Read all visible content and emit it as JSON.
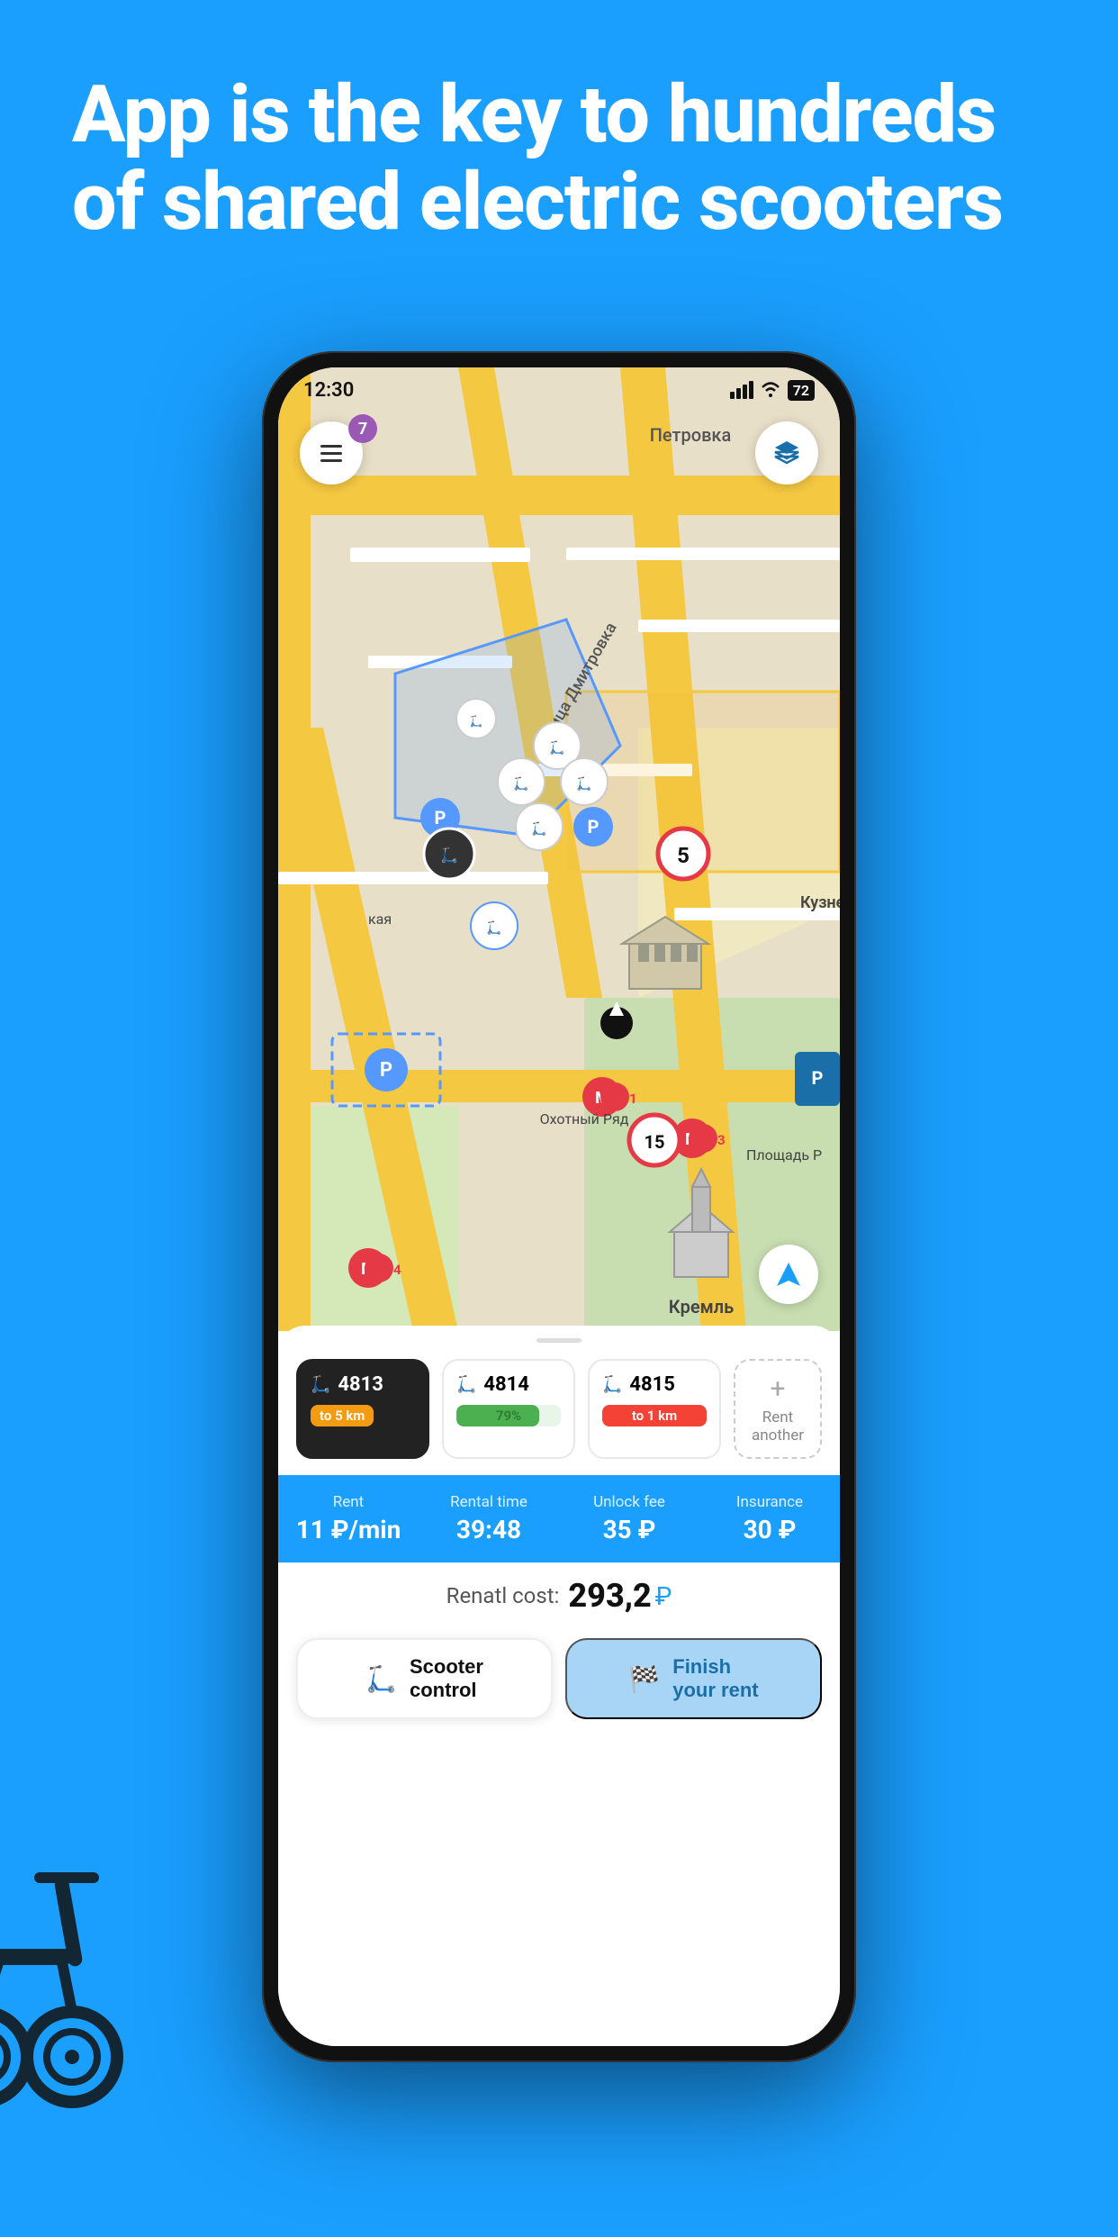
{
  "header": {
    "title": "App is the key to hundreds of shared electric scooters"
  },
  "status_bar": {
    "time": "12:30",
    "battery": "72"
  },
  "map": {
    "street_label": "Петровка",
    "street2": "Улица Дмитровка",
    "metro1": "Охотный Ряд",
    "metro2": "Площадь Р",
    "metro3": "Кузнецки",
    "kremlin": "Кремль",
    "speed_limit_5": "5",
    "speed_limit_15": "15"
  },
  "scooter_cards": [
    {
      "id": "4813",
      "badge_type": "orange",
      "badge_text": "to 5 km",
      "active": true
    },
    {
      "id": "4814",
      "badge_type": "green_bar",
      "badge_text": "79%",
      "battery_pct": 79,
      "active": false
    },
    {
      "id": "4815",
      "badge_type": "red",
      "badge_text": "to 1 km",
      "active": false
    }
  ],
  "rent_another": {
    "label": "Rent another"
  },
  "info": {
    "rent_label": "Rent",
    "rent_value": "11 ₽/min",
    "time_label": "Rental time",
    "time_value": "39:48",
    "unlock_label": "Unlock fee",
    "unlock_value": "35 ₽",
    "insurance_label": "Insurance",
    "insurance_value": "30 ₽"
  },
  "cost": {
    "label": "Renatl cost:",
    "value": "293,2",
    "currency": "₽"
  },
  "buttons": {
    "scooter_control": "Scooter\ncontrol",
    "finish_rent_line1": "Finish",
    "finish_rent_line2": "your rent"
  },
  "menu_badge": "7"
}
